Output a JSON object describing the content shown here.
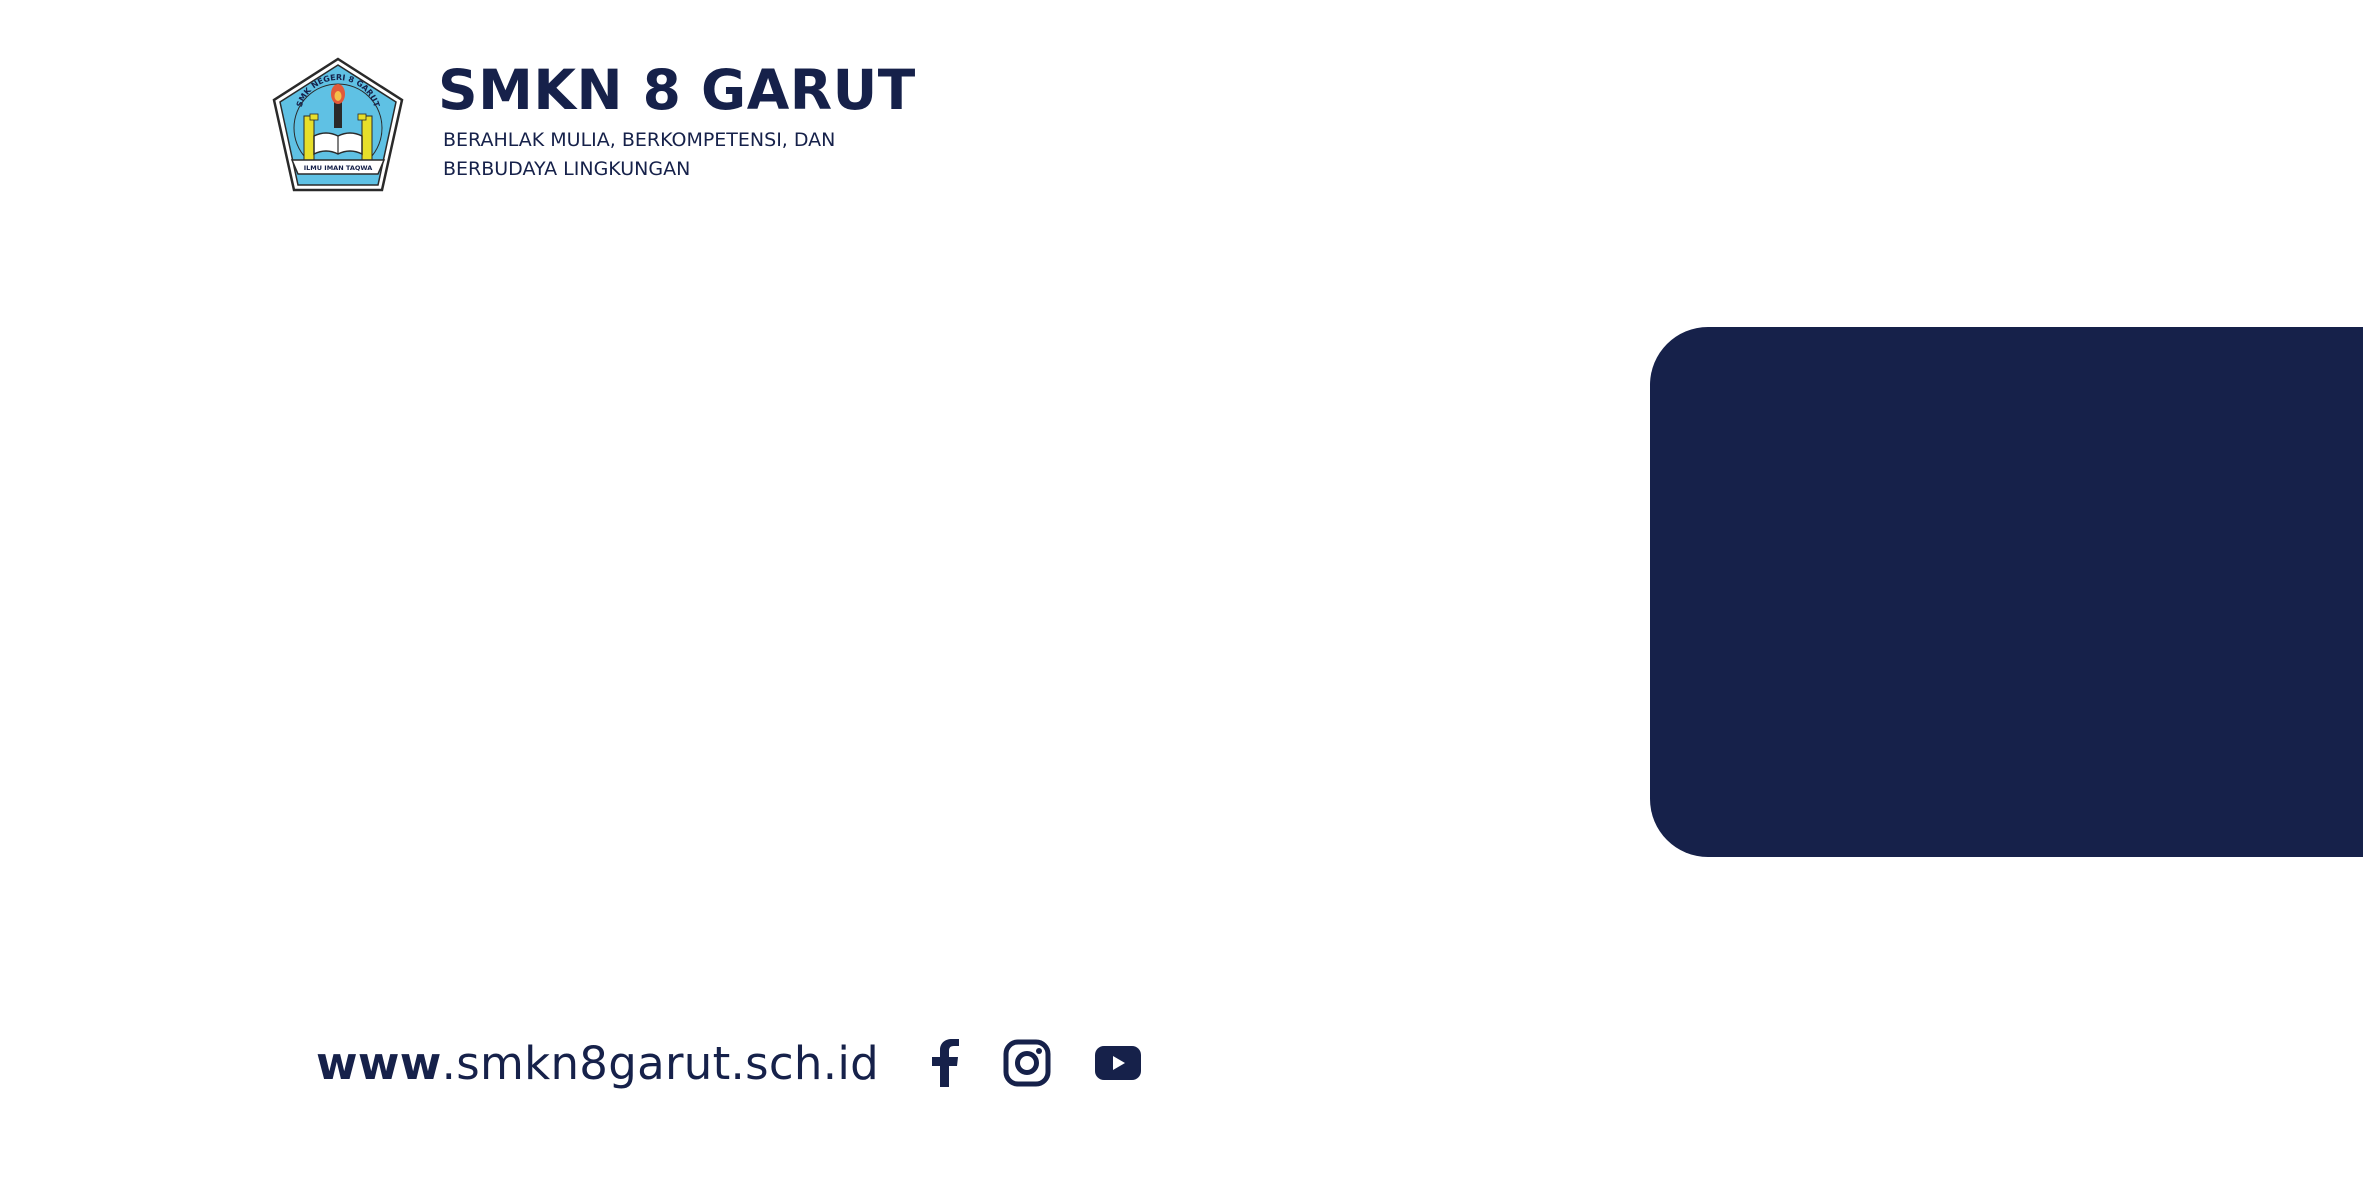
{
  "header": {
    "logo": {
      "icon": "school-emblem",
      "top_text": "SMK NEGERI 8 GARUT",
      "bottom_text": "ILMU IMAN TAQWA"
    },
    "title": "SMKN 8 GARUT",
    "tagline": "BERAHLAK MULIA, BERKOMPETENSI, DAN BERBUDAYA LINGKUNGAN"
  },
  "footer": {
    "website_prefix": "www",
    "website_domain": ".smkn8garut.sch.id",
    "socials": [
      {
        "icon": "facebook-icon"
      },
      {
        "icon": "instagram-icon"
      },
      {
        "icon": "youtube-icon"
      }
    ]
  },
  "colors": {
    "navy": "#16214a",
    "emblem_blue": "#5fc1e4",
    "background": "#ffffff"
  }
}
